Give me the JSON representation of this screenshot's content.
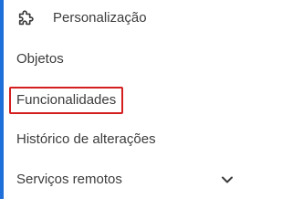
{
  "colors": {
    "accent_bar": "#1e6fd9",
    "highlight_border": "#d51f1f",
    "text": "#3c3c3c"
  },
  "nav": {
    "items": [
      {
        "label": "Personalização",
        "icon": "puzzle-icon"
      },
      {
        "label": "Objetos"
      },
      {
        "label": "Funcionalidades",
        "highlighted": true
      },
      {
        "label": "Histórico de alterações"
      },
      {
        "label": "Serviços remotos",
        "icon": "chevron-down-icon",
        "expandable": true
      }
    ]
  }
}
